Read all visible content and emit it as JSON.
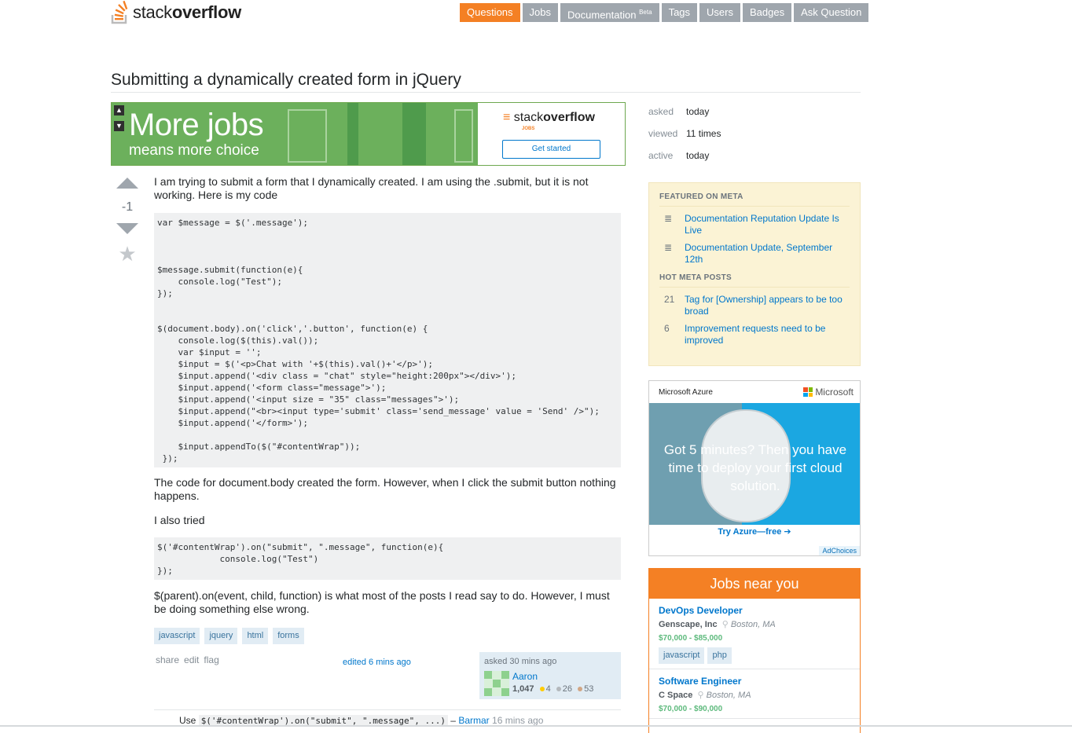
{
  "header": {
    "logo_prefix": "stack",
    "logo_bold": "overflow",
    "nav": [
      {
        "label": "Questions",
        "active": true
      },
      {
        "label": "Jobs"
      },
      {
        "label": "Documentation",
        "badge": "Beta"
      },
      {
        "label": "Tags"
      },
      {
        "label": "Users"
      },
      {
        "label": "Badges"
      },
      {
        "label": "Ask Question"
      }
    ]
  },
  "question": {
    "title": "Submitting a dynamically created form in jQuery",
    "votes": "-1",
    "body1": "I am trying to submit a form that I dynamically created. I am using the .submit, but it is not working. Here is my code",
    "body2": "The code for document.body created the form. However, when I click the submit button nothing happens.",
    "body3": "I also tried",
    "body4": "$(parent).on(event, child, function) is what most of the posts I read say to do. However, I must be doing something else wrong.",
    "code1": "var $message = $('.message');\n\n\n\n$message.submit(function(e){\n    console.log(\"Test\");\n});\n\n\n$(document.body).on('click','.button', function(e) {\n    console.log($(this).val());\n    var $input = '';\n    $input = $('<p>Chat with '+$(this).val()+'</p>');\n    $input.append('<div class = \"chat\" style=\"height:200px\"></div>');\n    $input.append('<form class=\"message\">');\n    $input.append('<input size = \"35\" class=\"messages\">');\n    $input.append(\"<br><input type='submit' class='send_message' value = 'Send' />\");\n    $input.append('</form>');\n\n    $input.appendTo($(\"#contentWrap\"));\n });",
    "code2": "$('#contentWrap').on(\"submit\", \".message\", function(e){\n            console.log(\"Test\")\n});",
    "tags": [
      "javascript",
      "jquery",
      "html",
      "forms"
    ],
    "menu": [
      "share",
      "edit",
      "flag"
    ],
    "edited": "edited 6 mins ago",
    "owner": {
      "asked": "asked 30 mins ago",
      "name": "Aaron",
      "rep": "1,047",
      "gold": "4",
      "silver": "26",
      "bronze": "53"
    },
    "comment": {
      "prefix": "Use",
      "code": "$('#contentWrap').on(\"submit\", \".message\", ...)",
      "dash": "–",
      "user": "Barmar",
      "time": "16 mins ago"
    }
  },
  "banner": {
    "headline": "More jobs",
    "sub": "means more choice",
    "logo_prefix": "stack",
    "logo_bold": "overflow",
    "logo_tag": "JOBS",
    "cta": "Get started"
  },
  "stats": [
    {
      "key": "asked",
      "value": "today"
    },
    {
      "key": "viewed",
      "value": "11 times"
    },
    {
      "key": "active",
      "value": "today"
    }
  ],
  "meta": {
    "featured_title": "FEATURED ON META",
    "featured": [
      "Documentation Reputation Update Is Live",
      "Documentation Update, September 12th"
    ],
    "hot_title": "HOT META POSTS",
    "hot": [
      {
        "count": "21",
        "title": "Tag for [Ownership] appears to be too broad"
      },
      {
        "count": "6",
        "title": "Improvement requests need to be improved"
      }
    ]
  },
  "azure_ad": {
    "brand": "Microsoft Azure",
    "ms": "Microsoft",
    "text": "Got 5 minutes? Then you have time to deploy your first cloud solution.",
    "cta": "Try Azure—free",
    "adchoices": "AdChoices"
  },
  "jobs": {
    "title": "Jobs near you",
    "items": [
      {
        "title": "DevOps Developer",
        "company": "Genscape, Inc",
        "location": "Boston, MA",
        "salary": "$70,000 - $85,000",
        "tags": [
          "javascript",
          "php"
        ]
      },
      {
        "title": "Software Engineer",
        "company": "C Space",
        "location": "Boston, MA",
        "salary": "$70,000 - $90,000",
        "tags": []
      }
    ]
  },
  "colors": {
    "accent": "#f48024",
    "link": "#0077cc",
    "tag_bg": "#e1ecf4"
  }
}
